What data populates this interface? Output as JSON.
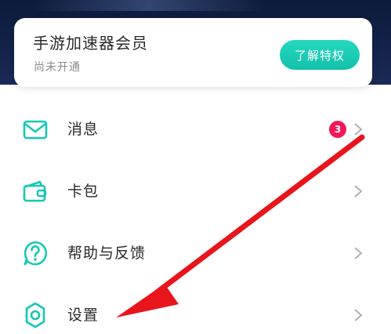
{
  "membership": {
    "title": "手游加速器会员",
    "status": "尚未开通",
    "button_label": "了解特权"
  },
  "menu": {
    "items": [
      {
        "label": "消息",
        "icon": "message-envelope-icon",
        "badge": "3"
      },
      {
        "label": "卡包",
        "icon": "wallet-icon"
      },
      {
        "label": "帮助与反馈",
        "icon": "help-question-icon"
      },
      {
        "label": "设置",
        "icon": "settings-gear-icon"
      }
    ]
  },
  "colors": {
    "header_bg": "#0d1a3a",
    "accent": "#14c8b4",
    "badge": "#f0185a",
    "annotation_arrow": "#e8151b"
  }
}
